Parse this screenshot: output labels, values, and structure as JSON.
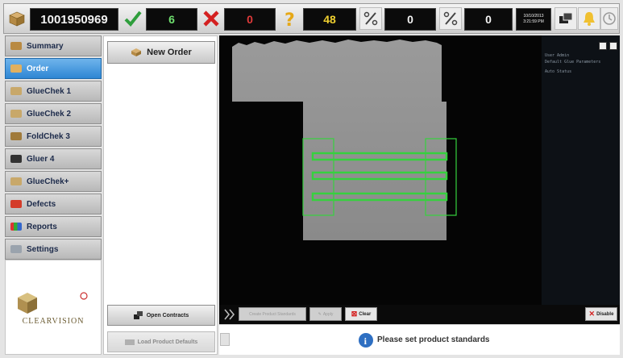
{
  "toolbar": {
    "order_number": "1001950969",
    "good_count": "6",
    "reject_count": "0",
    "unknown_count": "48",
    "percent_a": "0",
    "percent_b": "0",
    "datetime_line1": "10/10/2013",
    "datetime_line2": "3:21:59 PM"
  },
  "nav": {
    "items": [
      {
        "label": "Summary"
      },
      {
        "label": "Order"
      },
      {
        "label": "GlueChek 1"
      },
      {
        "label": "GlueChek 2"
      },
      {
        "label": "FoldChek 3"
      },
      {
        "label": "Gluer 4"
      },
      {
        "label": "GlueChek+"
      },
      {
        "label": "Defects"
      },
      {
        "label": "Reports"
      },
      {
        "label": "Settings"
      }
    ],
    "active_index": 1
  },
  "brand": {
    "name": "CLEARVISION"
  },
  "orders": {
    "new_order_label": "New Order",
    "open_contracts_label": "Open Contracts",
    "load_defaults_label": "Load Product Defaults"
  },
  "camera": {
    "side_text": [
      "User Admin",
      "Default Glue Parameters",
      "Auto Status"
    ],
    "controls": {
      "standards_label": "Create Product Standards",
      "apply_label": "Apply",
      "clear_label": "Clear",
      "disable_label": "Disable"
    }
  },
  "status": {
    "message": "Please set product standards"
  },
  "colors": {
    "accent": "#2e86d3",
    "good": "#2e9e3c",
    "reject": "#d42020",
    "warning": "#e6a817",
    "roi": "#36d13e"
  }
}
